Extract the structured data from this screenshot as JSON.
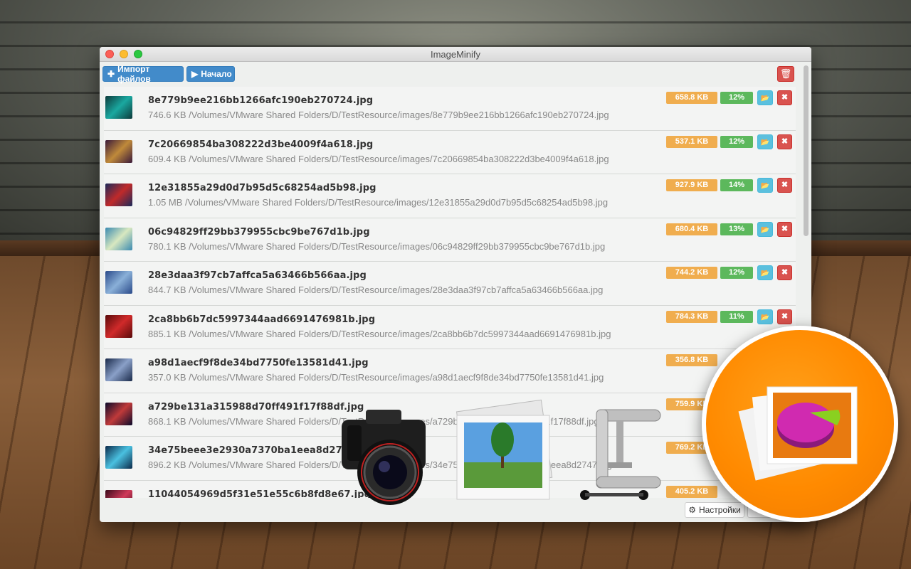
{
  "window": {
    "title": "ImageMinify"
  },
  "toolbar": {
    "import_label": "Импорт файлов",
    "start_label": "Начало"
  },
  "files": [
    {
      "name": "8e779b9ee216bb1266afc190eb270724.jpg",
      "path": "746.6 KB /Volumes/VMware Shared Folders/D/TestResource/images/8e779b9ee216bb1266afc190eb270724.jpg",
      "new_size": "658.8 KB",
      "saving": "12%",
      "thumb_colors": [
        "#0c3a3a",
        "#1aa8a0"
      ]
    },
    {
      "name": "7c20669854ba308222d3be4009f4a618.jpg",
      "path": "609.4 KB /Volumes/VMware Shared Folders/D/TestResource/images/7c20669854ba308222d3be4009f4a618.jpg",
      "new_size": "537.1 KB",
      "saving": "12%",
      "thumb_colors": [
        "#3a1a3a",
        "#c08a3a"
      ]
    },
    {
      "name": "12e31855a29d0d7b95d5c68254ad5b98.jpg",
      "path": "1.05 MB /Volumes/VMware Shared Folders/D/TestResource/images/12e31855a29d0d7b95d5c68254ad5b98.jpg",
      "new_size": "927.9 KB",
      "saving": "14%",
      "thumb_colors": [
        "#1a2a5a",
        "#c02a2a"
      ]
    },
    {
      "name": "06c94829ff29bb379955cbc9be767d1b.jpg",
      "path": "780.1 KB /Volumes/VMware Shared Folders/D/TestResource/images/06c94829ff29bb379955cbc9be767d1b.jpg",
      "new_size": "680.4 KB",
      "saving": "13%",
      "thumb_colors": [
        "#3a8ab0",
        "#d8e8c0"
      ]
    },
    {
      "name": "28e3daa3f97cb7affca5a63466b566aa.jpg",
      "path": "844.7 KB /Volumes/VMware Shared Folders/D/TestResource/images/28e3daa3f97cb7affca5a63466b566aa.jpg",
      "new_size": "744.2 KB",
      "saving": "12%",
      "thumb_colors": [
        "#2a4a8a",
        "#8ab0d8"
      ]
    },
    {
      "name": "2ca8bb6b7dc5997344aad6691476981b.jpg",
      "path": "885.1 KB /Volumes/VMware Shared Folders/D/TestResource/images/2ca8bb6b7dc5997344aad6691476981b.jpg",
      "new_size": "784.3 KB",
      "saving": "11%",
      "thumb_colors": [
        "#5a0a0a",
        "#d02a2a"
      ]
    },
    {
      "name": "a98d1aecf9f8de34bd7750fe13581d41.jpg",
      "path": "357.0 KB /Volumes/VMware Shared Folders/D/TestResource/images/a98d1aecf9f8de34bd7750fe13581d41.jpg",
      "new_size": "356.8 KB",
      "saving": "",
      "thumb_colors": [
        "#1a2a4a",
        "#8aa0c8"
      ]
    },
    {
      "name": "a729be131a315988d70ff491f17f88df.jpg",
      "path": "868.1 KB /Volumes/VMware Shared Folders/D/TestResource/images/a729be131a315988d70ff491f17f88df.jpg",
      "new_size": "759.9 KB",
      "saving": "",
      "thumb_colors": [
        "#0a0a2a",
        "#c03a3a"
      ]
    },
    {
      "name": "34e75beee3e2930a7370ba1eea8d2747.jpg",
      "path": "896.2 KB /Volumes/VMware Shared Folders/D/TestResource/images/34e75beee3e2930a7370ba1eea8d2747.jpg",
      "new_size": "769.2 KB",
      "saving": "",
      "thumb_colors": [
        "#0a2a4a",
        "#4ac0e0"
      ]
    },
    {
      "name": "11044054969d5f31e51e55c6b8fd8e67.jpg",
      "path": "",
      "new_size": "405.2 KB",
      "saving": "",
      "thumb_colors": [
        "#3a0a1a",
        "#d03a5a"
      ]
    }
  ],
  "footer": {
    "settings_label": "Настройки"
  },
  "icons": {
    "import": "plus-icon",
    "start": "play-icon",
    "trash": "trash-icon",
    "folder": "folder-icon",
    "remove": "close-icon",
    "settings": "gear-icon"
  },
  "colors": {
    "primary": "#428bca",
    "size_badge": "#f0ad4e",
    "saving_badge": "#5cb85c",
    "folder_button": "#5bc0de",
    "danger": "#d9534f",
    "logo_orange": "#ff8a00"
  }
}
